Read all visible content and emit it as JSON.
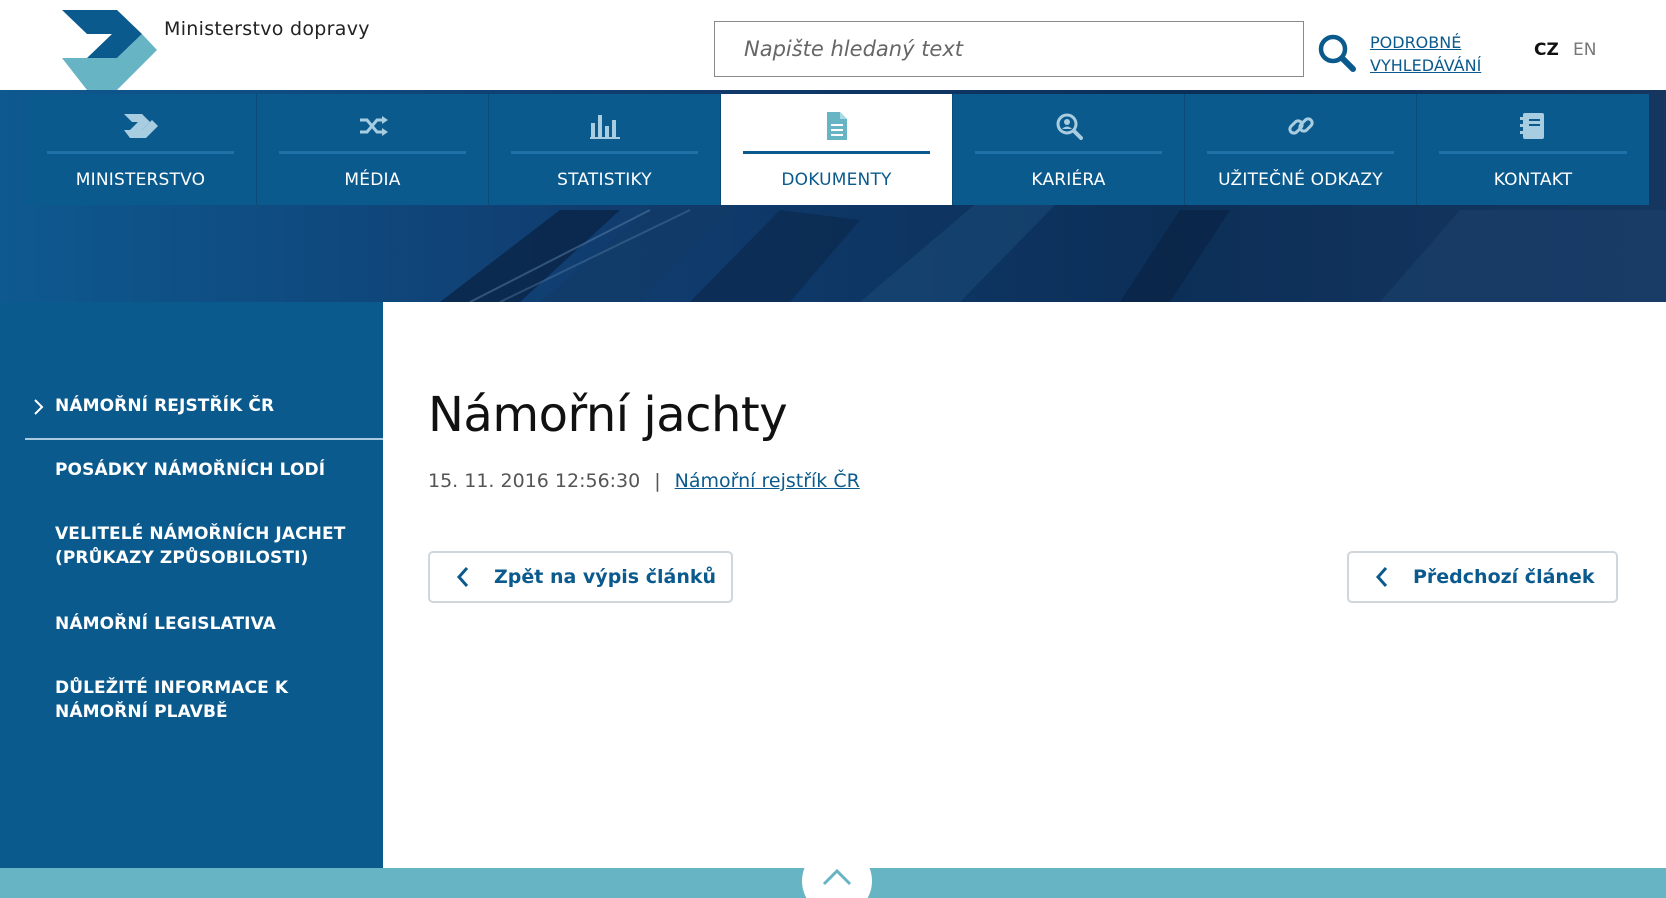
{
  "header": {
    "brand": "Ministerstvo dopravy",
    "search_placeholder": "Napište hledaný text",
    "advanced_search": [
      "PODROBNÉ",
      "VYHLEDÁVÁNÍ"
    ],
    "lang_active": "CZ",
    "lang_other": "EN"
  },
  "nav": {
    "items": [
      {
        "label": "MINISTERSTVO",
        "icon": "arrow-logo-icon"
      },
      {
        "label": "MÉDIA",
        "icon": "shuffle-icon"
      },
      {
        "label": "STATISTIKY",
        "icon": "bar-chart-icon"
      },
      {
        "label": "DOKUMENTY",
        "icon": "document-icon",
        "active": true
      },
      {
        "label": "KARIÉRA",
        "icon": "search-person-icon"
      },
      {
        "label": "UŽITEČNÉ ODKAZY",
        "icon": "link-icon"
      },
      {
        "label": "KONTAKT",
        "icon": "address-book-icon"
      }
    ]
  },
  "sidebar": {
    "items": [
      {
        "label": "NÁMOŘNÍ REJSTŘÍK ČR",
        "active": true
      },
      {
        "label": "POSÁDKY NÁMOŘNÍCH LODÍ"
      },
      {
        "label_lines": [
          "VELITELÉ NÁMOŘNÍCH JACHET",
          "(PRŮKAZY ZPŮSOBILOSTI)"
        ]
      },
      {
        "label": "NÁMOŘNÍ LEGISLATIVA"
      },
      {
        "label_lines": [
          "DŮLEŽITÉ INFORMACE K",
          "NÁMOŘNÍ PLAVBĚ"
        ]
      }
    ]
  },
  "article": {
    "title": "Námořní jachty",
    "date": "15. 11. 2016 12:56:30",
    "separator": "|",
    "category": "Námořní rejstřík ČR",
    "back_button": "Zpět na výpis článků",
    "prev_button": "Předchozí článek"
  },
  "colors": {
    "primary": "#0b5a8e",
    "footer": "#67b4c5",
    "logo_dark": "#0b5a8e",
    "logo_light": "#67b4c5"
  }
}
